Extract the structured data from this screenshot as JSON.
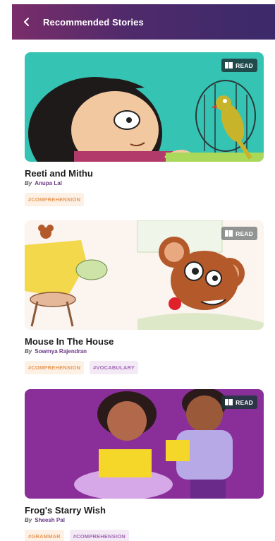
{
  "header": {
    "title": "Recommended Stories",
    "back_icon": "chevron-left-icon"
  },
  "badge_label": "READ",
  "stories": [
    {
      "title": "Reeti and Mithu",
      "by": "By",
      "author": "Anupa Lal",
      "tags": [
        "#COMPREHENSION"
      ]
    },
    {
      "title": "Mouse In The House",
      "by": "By",
      "author": "Sowmya Rajendran",
      "tags": [
        "#COMPREHENSION",
        "#VOCABULARY"
      ]
    },
    {
      "title": "Frog's Starry Wish",
      "by": "By",
      "author": "Sheesh Pal",
      "tags": [
        "#GRAMMAR",
        "#COMPREHENSION"
      ]
    }
  ],
  "colors": {
    "header_start": "#7a2d6a",
    "header_end": "#3b2a6a",
    "author": "#6a3a86",
    "tag_orange": "#e59a5a",
    "tag_purple": "#a06ab5"
  }
}
